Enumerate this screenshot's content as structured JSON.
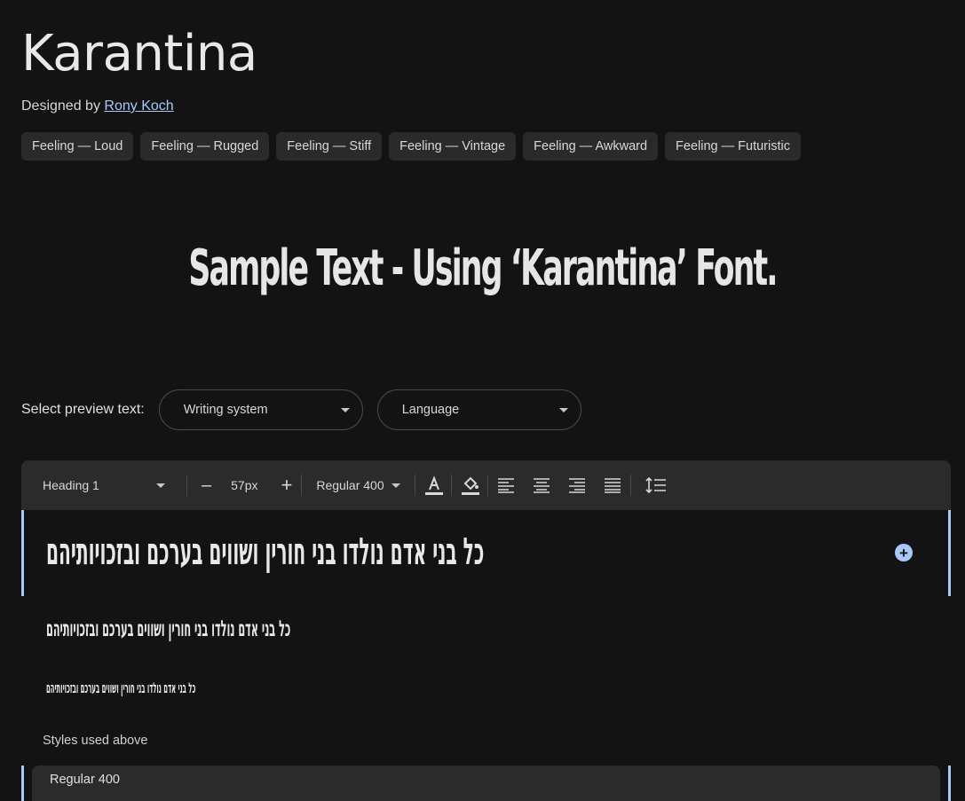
{
  "font": {
    "name": "Karantina",
    "designed_by_label": "Designed by",
    "designer": "Rony Koch",
    "tags": [
      "Feeling — Loud",
      "Feeling — Rugged",
      "Feeling — Stiff",
      "Feeling — Vintage",
      "Feeling — Awkward",
      "Feeling — Futuristic"
    ],
    "sample_text": "Sample Text - Using ‘Karantina’ Font."
  },
  "preview": {
    "label": "Select preview text:",
    "writing_system": "Writing system",
    "language": "Language"
  },
  "toolbar": {
    "style": "Heading 1",
    "decrease": "–",
    "size": "57px",
    "increase": "+",
    "weight": "Regular 400"
  },
  "previews": {
    "heading_text": "כל בני אדם נולדו בני חורין ושווים בערכם ובזכויותיהם",
    "sub_text": "כל בני אדם נולדו בני חורין ושווים בערכם ובזכויותיהם",
    "small_text": "כל בני אדם נולדו בני חורין ושווים בערכם ובזכויותיהם"
  },
  "styles_used": {
    "label": "Styles used above",
    "first": "Regular 400"
  },
  "colors": {
    "background": "#131313",
    "accent": "#a8c7fa",
    "chip": "#2a2a2a",
    "toolbar": "#2b2b2b"
  }
}
